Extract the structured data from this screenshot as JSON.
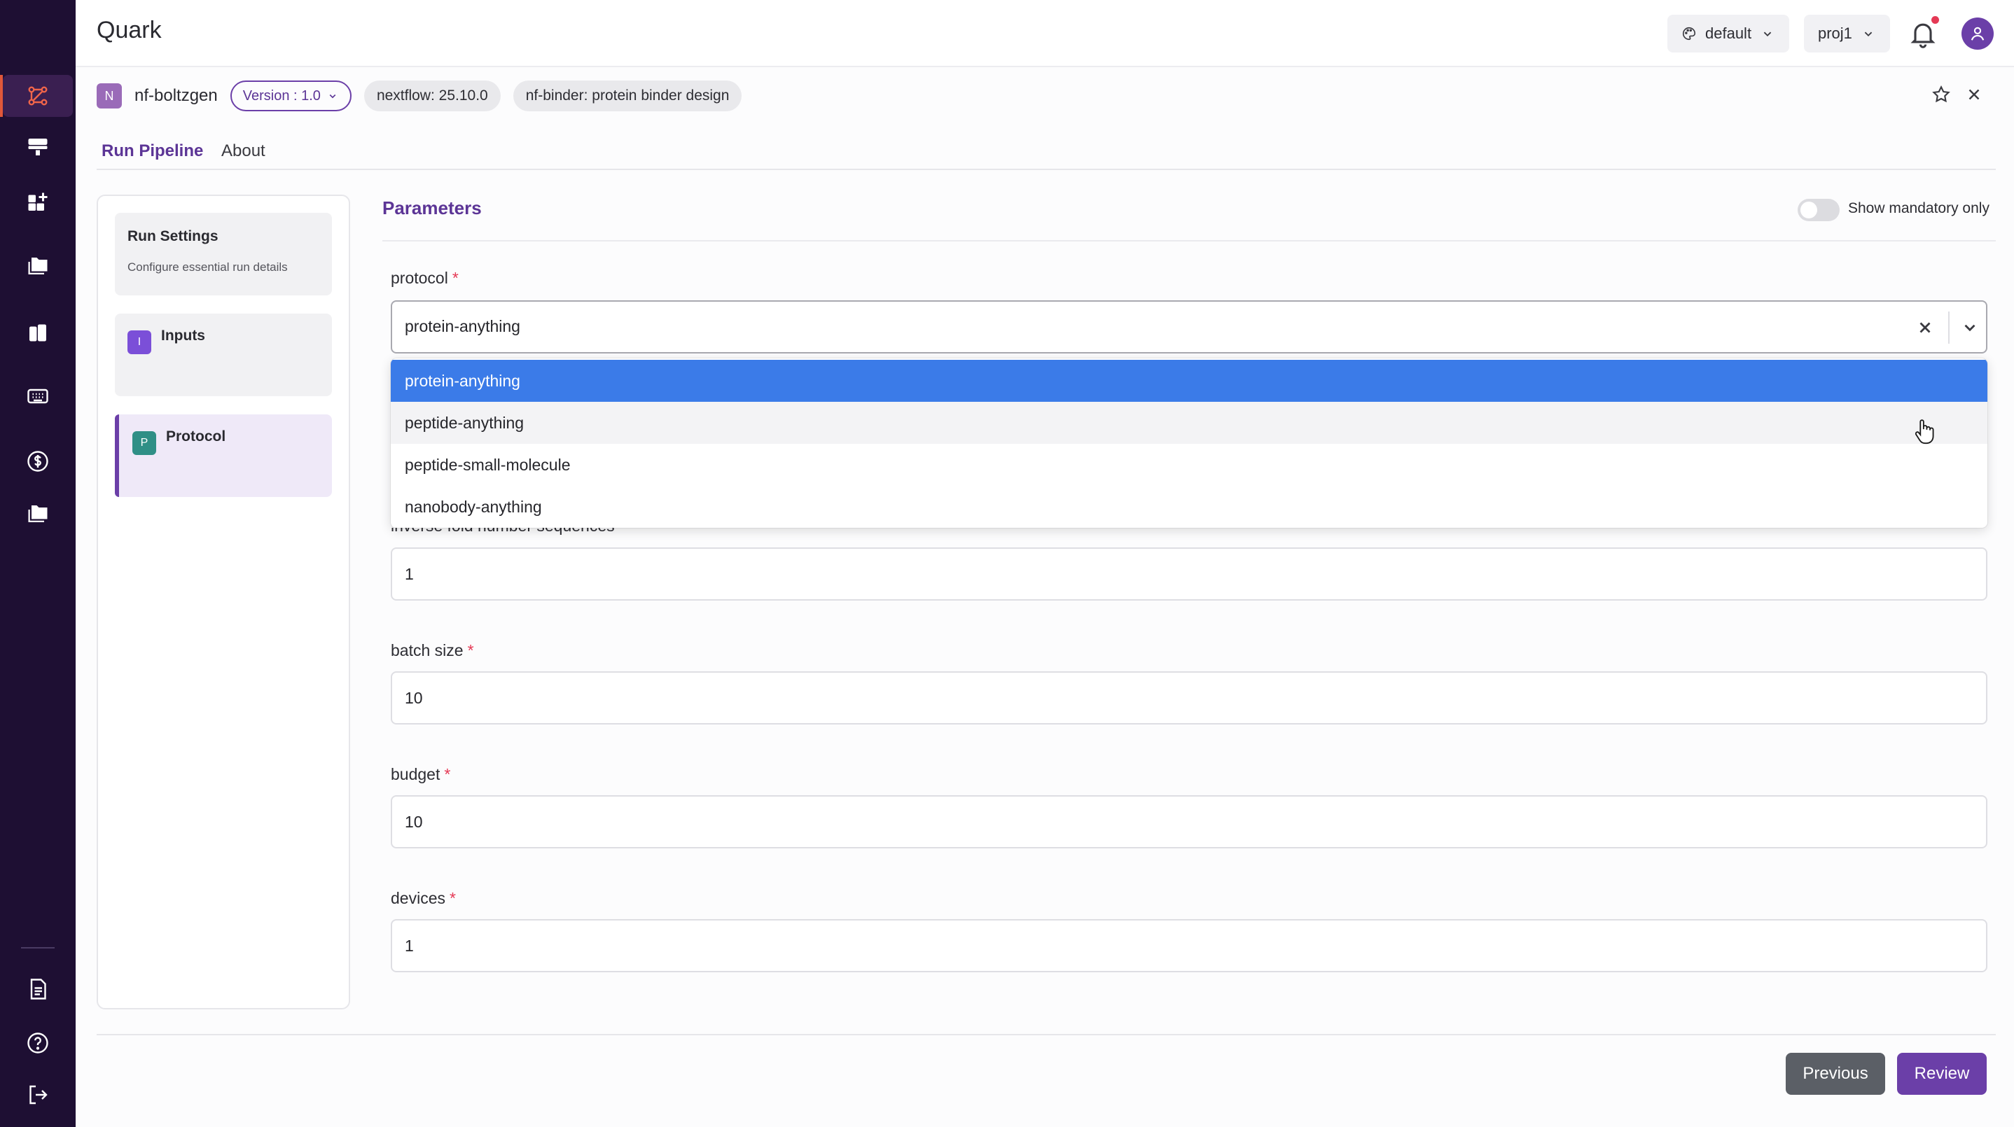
{
  "app": {
    "title": "Quark"
  },
  "header": {
    "theme_label": "default",
    "project_label": "proj1"
  },
  "pipeline": {
    "badge": "N",
    "name": "nf-boltzgen",
    "version_label": "Version : 1.0",
    "tags": [
      "nextflow: 25.10.0",
      "nf-binder: protein binder design"
    ]
  },
  "tabs": [
    {
      "label": "Run Pipeline",
      "active": true
    },
    {
      "label": "About",
      "active": false
    }
  ],
  "steps": [
    {
      "title": "Run Settings",
      "subtitle": "Configure essential run details"
    },
    {
      "icon": "I",
      "title": "Inputs",
      "icon_color": "#7b4fd8"
    },
    {
      "icon": "P",
      "title": "Protocol",
      "icon_color": "#2f8f86",
      "active": true
    }
  ],
  "parameters": {
    "title": "Parameters",
    "mandatory_toggle_label": "Show mandatory only",
    "required_mark": "*",
    "protocol": {
      "label": "protocol",
      "value": "protein-anything",
      "options": [
        "protein-anything",
        "peptide-anything",
        "peptide-small-molecule",
        "nanobody-anything"
      ]
    },
    "inverse_fold": {
      "label": "inverse fold number sequences",
      "value": "1"
    },
    "batch_size": {
      "label": "batch size",
      "value": "10"
    },
    "budget": {
      "label": "budget",
      "value": "10"
    },
    "devices": {
      "label": "devices",
      "value": "1"
    }
  },
  "footer": {
    "previous_label": "Previous",
    "review_label": "Review"
  },
  "colors": {
    "sidebar_bg": "#1e0f33",
    "accent_purple": "#6b3fa8",
    "active_nav": "#e0573a",
    "selected_option": "#3b7be8",
    "notification_dot": "#e53955"
  }
}
